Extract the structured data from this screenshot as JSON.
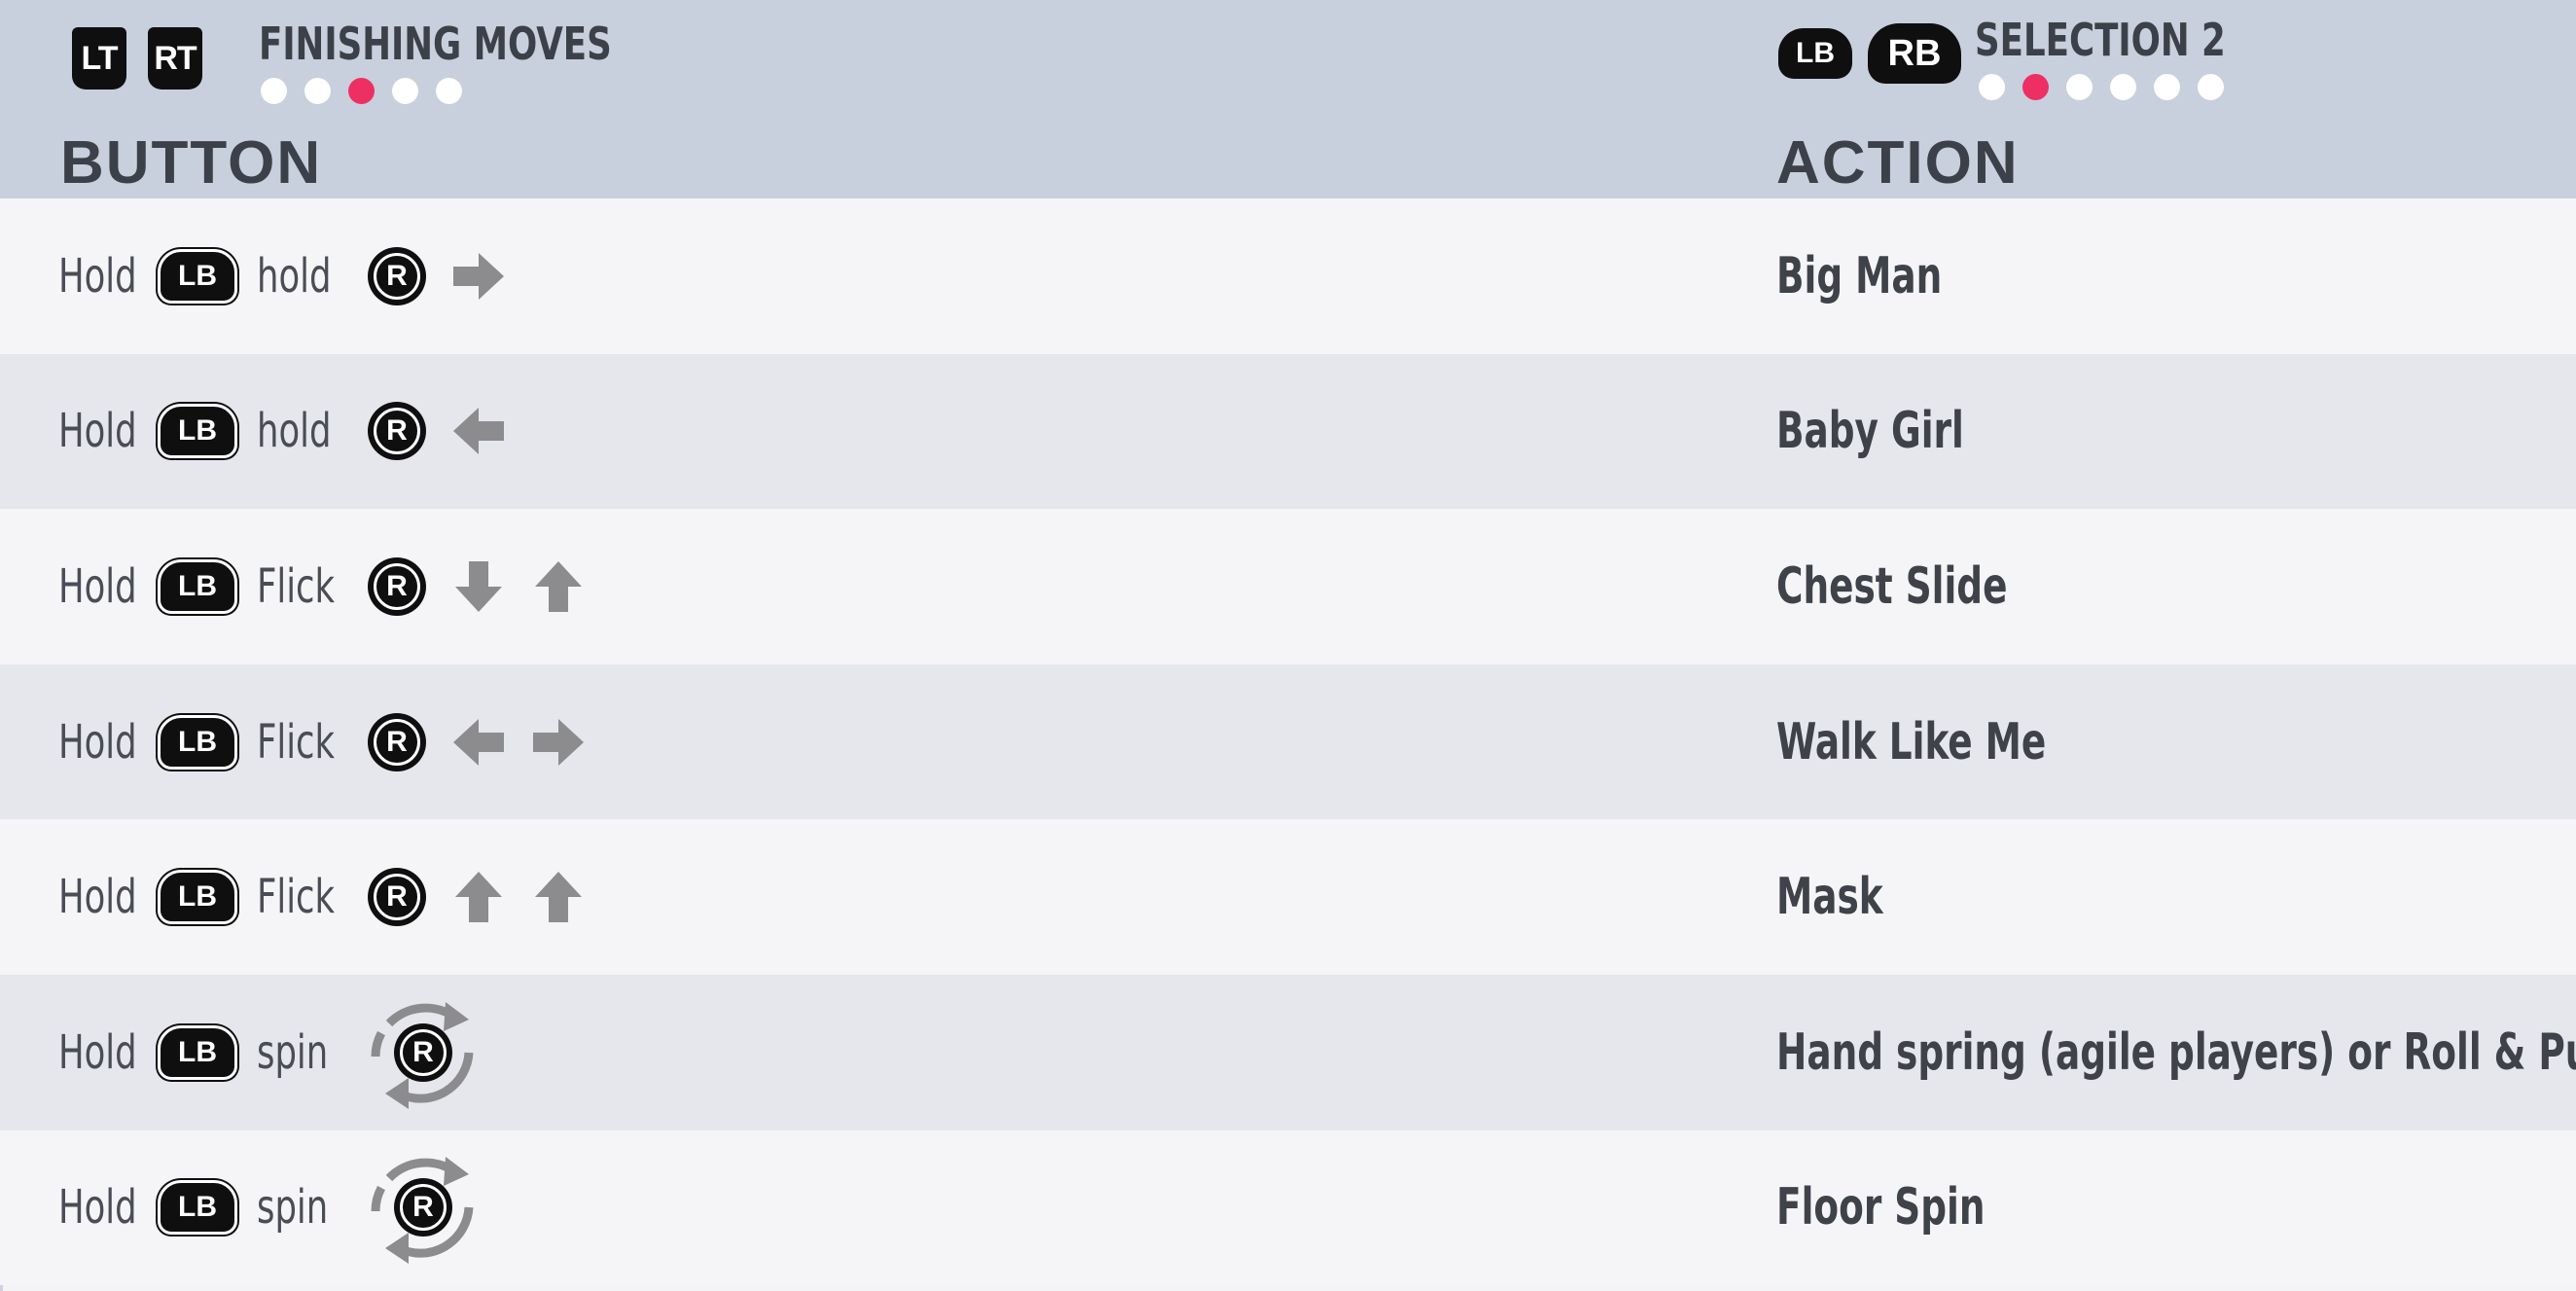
{
  "header": {
    "left_triggers": [
      "LT",
      "RT"
    ],
    "category_title": "FINISHING MOVES",
    "category_page_count": 5,
    "category_active_page": 3,
    "right_bumpers": [
      "LB",
      "RB"
    ],
    "selection_title": "SELECTION 2",
    "selection_page_count": 6,
    "selection_active_page": 2,
    "col_button": "BUTTON",
    "col_action": "ACTION"
  },
  "colors": {
    "header_bg": "#c8cfdd",
    "row_light": "#f5f5f8",
    "row_dark": "#e6e7ec",
    "active_dot": "#ee2f64",
    "arrow": "#8c8c8f"
  },
  "rows": [
    {
      "w1": "Hold",
      "lb": "LB",
      "w2": "hold",
      "stick": "R",
      "icons": [
        "arrow-right-icon"
      ],
      "action": "Big Man"
    },
    {
      "w1": "Hold",
      "lb": "LB",
      "w2": "hold",
      "stick": "R",
      "icons": [
        "arrow-left-icon"
      ],
      "action": "Baby Girl"
    },
    {
      "w1": "Hold",
      "lb": "LB",
      "w2": "Flick",
      "stick": "R",
      "icons": [
        "arrow-down-icon",
        "arrow-up-icon"
      ],
      "action": "Chest Slide"
    },
    {
      "w1": "Hold",
      "lb": "LB",
      "w2": "Flick",
      "stick": "R",
      "icons": [
        "arrow-left-icon",
        "arrow-right-icon"
      ],
      "action": "Walk Like Me"
    },
    {
      "w1": "Hold",
      "lb": "LB",
      "w2": "Flick",
      "stick": "R",
      "icons": [
        "arrow-up-icon",
        "arrow-up-icon"
      ],
      "action": "Mask"
    },
    {
      "w1": "Hold",
      "lb": "LB",
      "w2": "spin",
      "stick": "R",
      "icons": [
        "spin-icon"
      ],
      "action": "Hand spring (agile players) or Roll & Punch"
    },
    {
      "w1": "Hold",
      "lb": "LB",
      "w2": "spin",
      "stick": "R",
      "icons": [
        "spin-icon"
      ],
      "action": "Floor Spin"
    }
  ]
}
